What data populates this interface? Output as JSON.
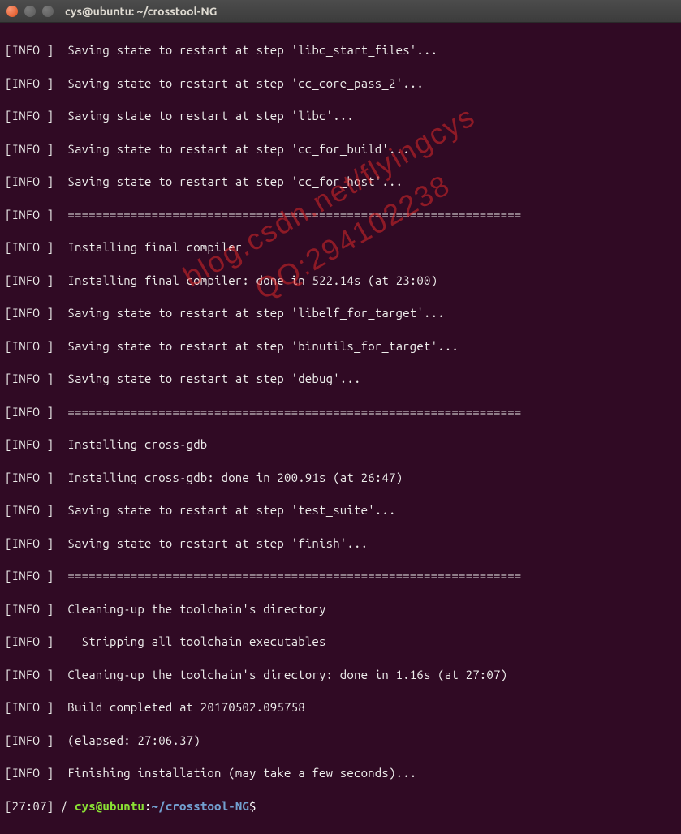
{
  "window": {
    "title": "cys@ubuntu: ~/crosstool-NG"
  },
  "lines": [
    "[INFO ]  Saving state to restart at step 'libc_start_files'...",
    "[INFO ]  Saving state to restart at step 'cc_core_pass_2'...",
    "[INFO ]  Saving state to restart at step 'libc'...",
    "[INFO ]  Saving state to restart at step 'cc_for_build'...",
    "[INFO ]  Saving state to restart at step 'cc_for_host'...",
    "[INFO ]  =================================================================",
    "[INFO ]  Installing final compiler",
    "[INFO ]  Installing final compiler: done in 522.14s (at 23:00)",
    "[INFO ]  Saving state to restart at step 'libelf_for_target'...",
    "[INFO ]  Saving state to restart at step 'binutils_for_target'...",
    "[INFO ]  Saving state to restart at step 'debug'...",
    "[INFO ]  =================================================================",
    "[INFO ]  Installing cross-gdb",
    "[INFO ]  Installing cross-gdb: done in 200.91s (at 26:47)",
    "[INFO ]  Saving state to restart at step 'test_suite'...",
    "[INFO ]  Saving state to restart at step 'finish'...",
    "[INFO ]  =================================================================",
    "[INFO ]  Cleaning-up the toolchain's directory",
    "[INFO ]    Stripping all toolchain executables",
    "[INFO ]  Cleaning-up the toolchain's directory: done in 1.16s (at 27:07)",
    "[INFO ]  Build completed at 20170502.095758",
    "[INFO ]  (elapsed: 27:06.37)",
    "[INFO ]  Finishing installation (may take a few seconds)..."
  ],
  "prompt": {
    "time_prefix": "[27:07] / ",
    "user_host": "cys@ubuntu",
    "colon": ":",
    "path": "~/crosstool-NG",
    "suffix": "$"
  },
  "watermark": {
    "line1": "blog.csdn.net/flyingcys",
    "line2": "QQ:294102238"
  }
}
